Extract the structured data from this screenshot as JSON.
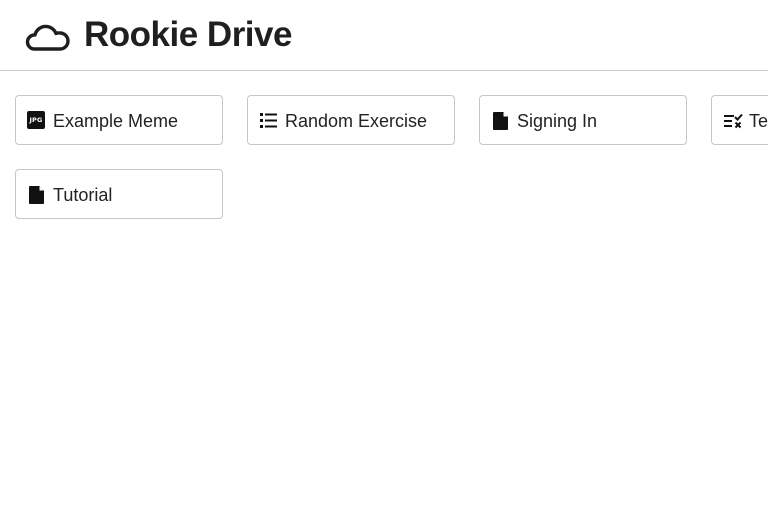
{
  "header": {
    "title": "Rookie Drive",
    "logo_icon": "cloud-icon"
  },
  "files": [
    {
      "label": "Example Meme",
      "icon": "jpg-file-icon",
      "badge": "JPG"
    },
    {
      "label": "Random Exercise",
      "icon": "list-icon"
    },
    {
      "label": "Signing In",
      "icon": "document-icon"
    },
    {
      "label": "Te",
      "icon": "checklist-icon"
    },
    {
      "label": "Tutorial",
      "icon": "document-icon"
    }
  ]
}
